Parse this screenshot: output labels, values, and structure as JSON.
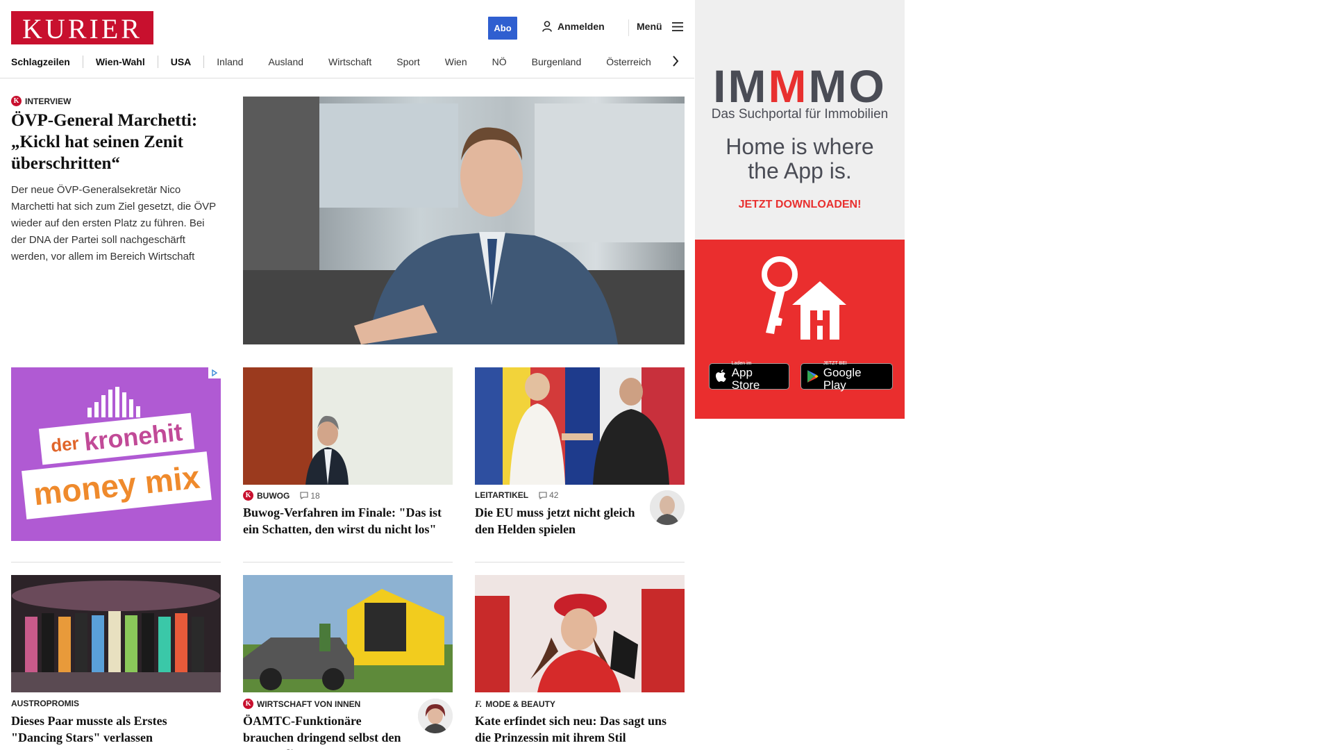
{
  "header": {
    "logo": "KURIER",
    "abo": "Abo",
    "login": "Anmelden",
    "menu": "Menü"
  },
  "nav": {
    "items": [
      "Schlagzeilen",
      "Wien-Wahl",
      "USA",
      "Inland",
      "Ausland",
      "Wirtschaft",
      "Sport",
      "Wien",
      "NÖ",
      "Burgenland",
      "Österreich"
    ]
  },
  "lead": {
    "kicker": "INTERVIEW",
    "title": "ÖVP-General Marchetti: „Kickl hat seinen Zenit überschritten“",
    "teaser": "Der neue ÖVP-Generalsekretär Nico Marchetti hat sich zum Ziel gesetzt, die ÖVP wieder auf den ersten Platz zu führen. Bei der DNA der Partei soll nachgeschärft werden, vor allem im Bereich Wirtschaft"
  },
  "ad_left": {
    "line1_a": "der",
    "line1_b": "kronehit",
    "line2": "money mix"
  },
  "cards": [
    {
      "kicker": "BUWOG",
      "comments": "18",
      "title": "Buwog-Verfahren im Finale: \"Das ist ein Schatten, den wirst du nicht los\""
    },
    {
      "kicker": "LEITARTIKEL",
      "comments": "42",
      "title": "Die EU muss jetzt nicht gleich den Helden spielen"
    },
    {
      "kicker": "AUSTROPROMIS",
      "title": "Dieses Paar musste als Erstes \"Dancing Stars\" verlassen"
    },
    {
      "kicker": "WIRTSCHAFT VON INNEN",
      "title": "ÖAMTC-Funktionäre brauchen dringend selbst den Pannendienst"
    },
    {
      "kicker": "MODE & BEAUTY",
      "title": "Kate erfindet sich neu: Das sagt uns die Prinzessin mit ihrem Stil"
    }
  ],
  "ad_right": {
    "logo_a": "IM",
    "logo_b": "M",
    "logo_c": "MO",
    "subtitle": "Das Suchportal für Immobilien",
    "claim_1": "Home is where",
    "claim_2": "the App is.",
    "cta": "JETZT DOWNLOADEN!",
    "appstore_small": "Laden im",
    "appstore_big": "App Store",
    "googleplay_small": "JETZT BEI",
    "googleplay_big": "Google Play"
  },
  "colors": {
    "brand_red": "#c8102e",
    "abo_blue": "#2f5fd0",
    "immo_red": "#ea2e2e",
    "kronehit_purple": "#b05ad3"
  }
}
